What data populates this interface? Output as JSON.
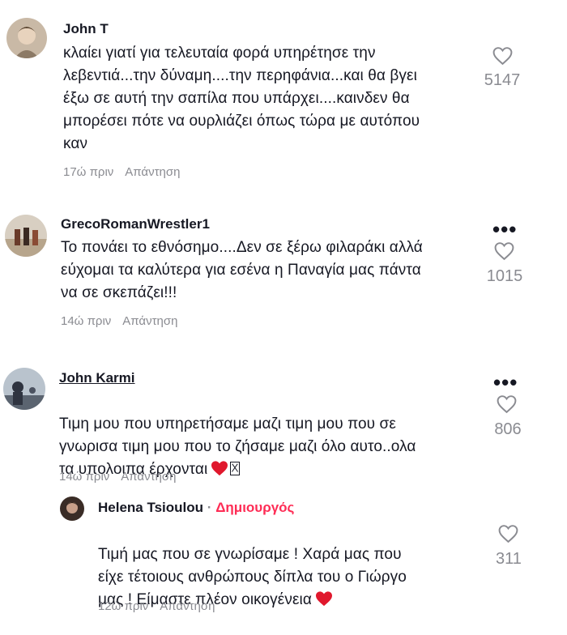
{
  "comments": [
    {
      "username": "John T",
      "text": "κλαίει γιατί για τελευταία φορά υπηρέτησε την\nλεβεντιά...την δύναμη....την περηφάνια...και θα βγει\nέξω σε αυτή την σαπίλα που υπάρχει....καινδεν θα\nμπορέσει πότε να ουρλιάζει όπως τώρα με αυτόπου\nκαν",
      "time": "17ώ πριν",
      "reply_label": "Απάντηση",
      "likes": "5147"
    },
    {
      "username": "GrecoRomanWrestler1",
      "text": "Το πονάει το εθνόσημο....Δεν σε ξέρω φιλαράκι αλλά\nεύχομαι τα καλύτερα για εσένα η Παναγία μας πάντα\nνα σε σκεπάζει!!!",
      "time": "14ώ πριν",
      "reply_label": "Απάντηση",
      "likes": "1015"
    },
    {
      "username": "John Karmi",
      "text": "Τιμη μου που υπηρετήσαμε μαζι τιμη μου που σε\nγνωρισα τιμη μου που το ζήσαμε μαζι όλο αυτο..ολα\nτα υπολοιπα έρχονται",
      "time": "14ώ πριν",
      "reply_label": "Απάντηση",
      "likes": "806"
    }
  ],
  "reply": {
    "username": "Helena Tsioulou",
    "separator": "·",
    "creator_label": "Δημιουργός",
    "text": "Τιμή μας που σε γνωρίσαμε ! Χαρά μας που\nείχε τέτοιους ανθρώπους δίπλα του ο Γιώργο\nμας ! Είμαστε πλέον οικογένεια",
    "time": "12ώ πριν",
    "reply_label": "Απάντηση",
    "likes": "311"
  },
  "more_label": "•••",
  "colors": {
    "heart": "#fe2c55",
    "muted": "#8a8b91",
    "creator": "#fe2c55"
  },
  "icons": [
    "heart-outline-icon",
    "more-dots-icon",
    "red-heart-emoji",
    "missing-glyph-box"
  ]
}
